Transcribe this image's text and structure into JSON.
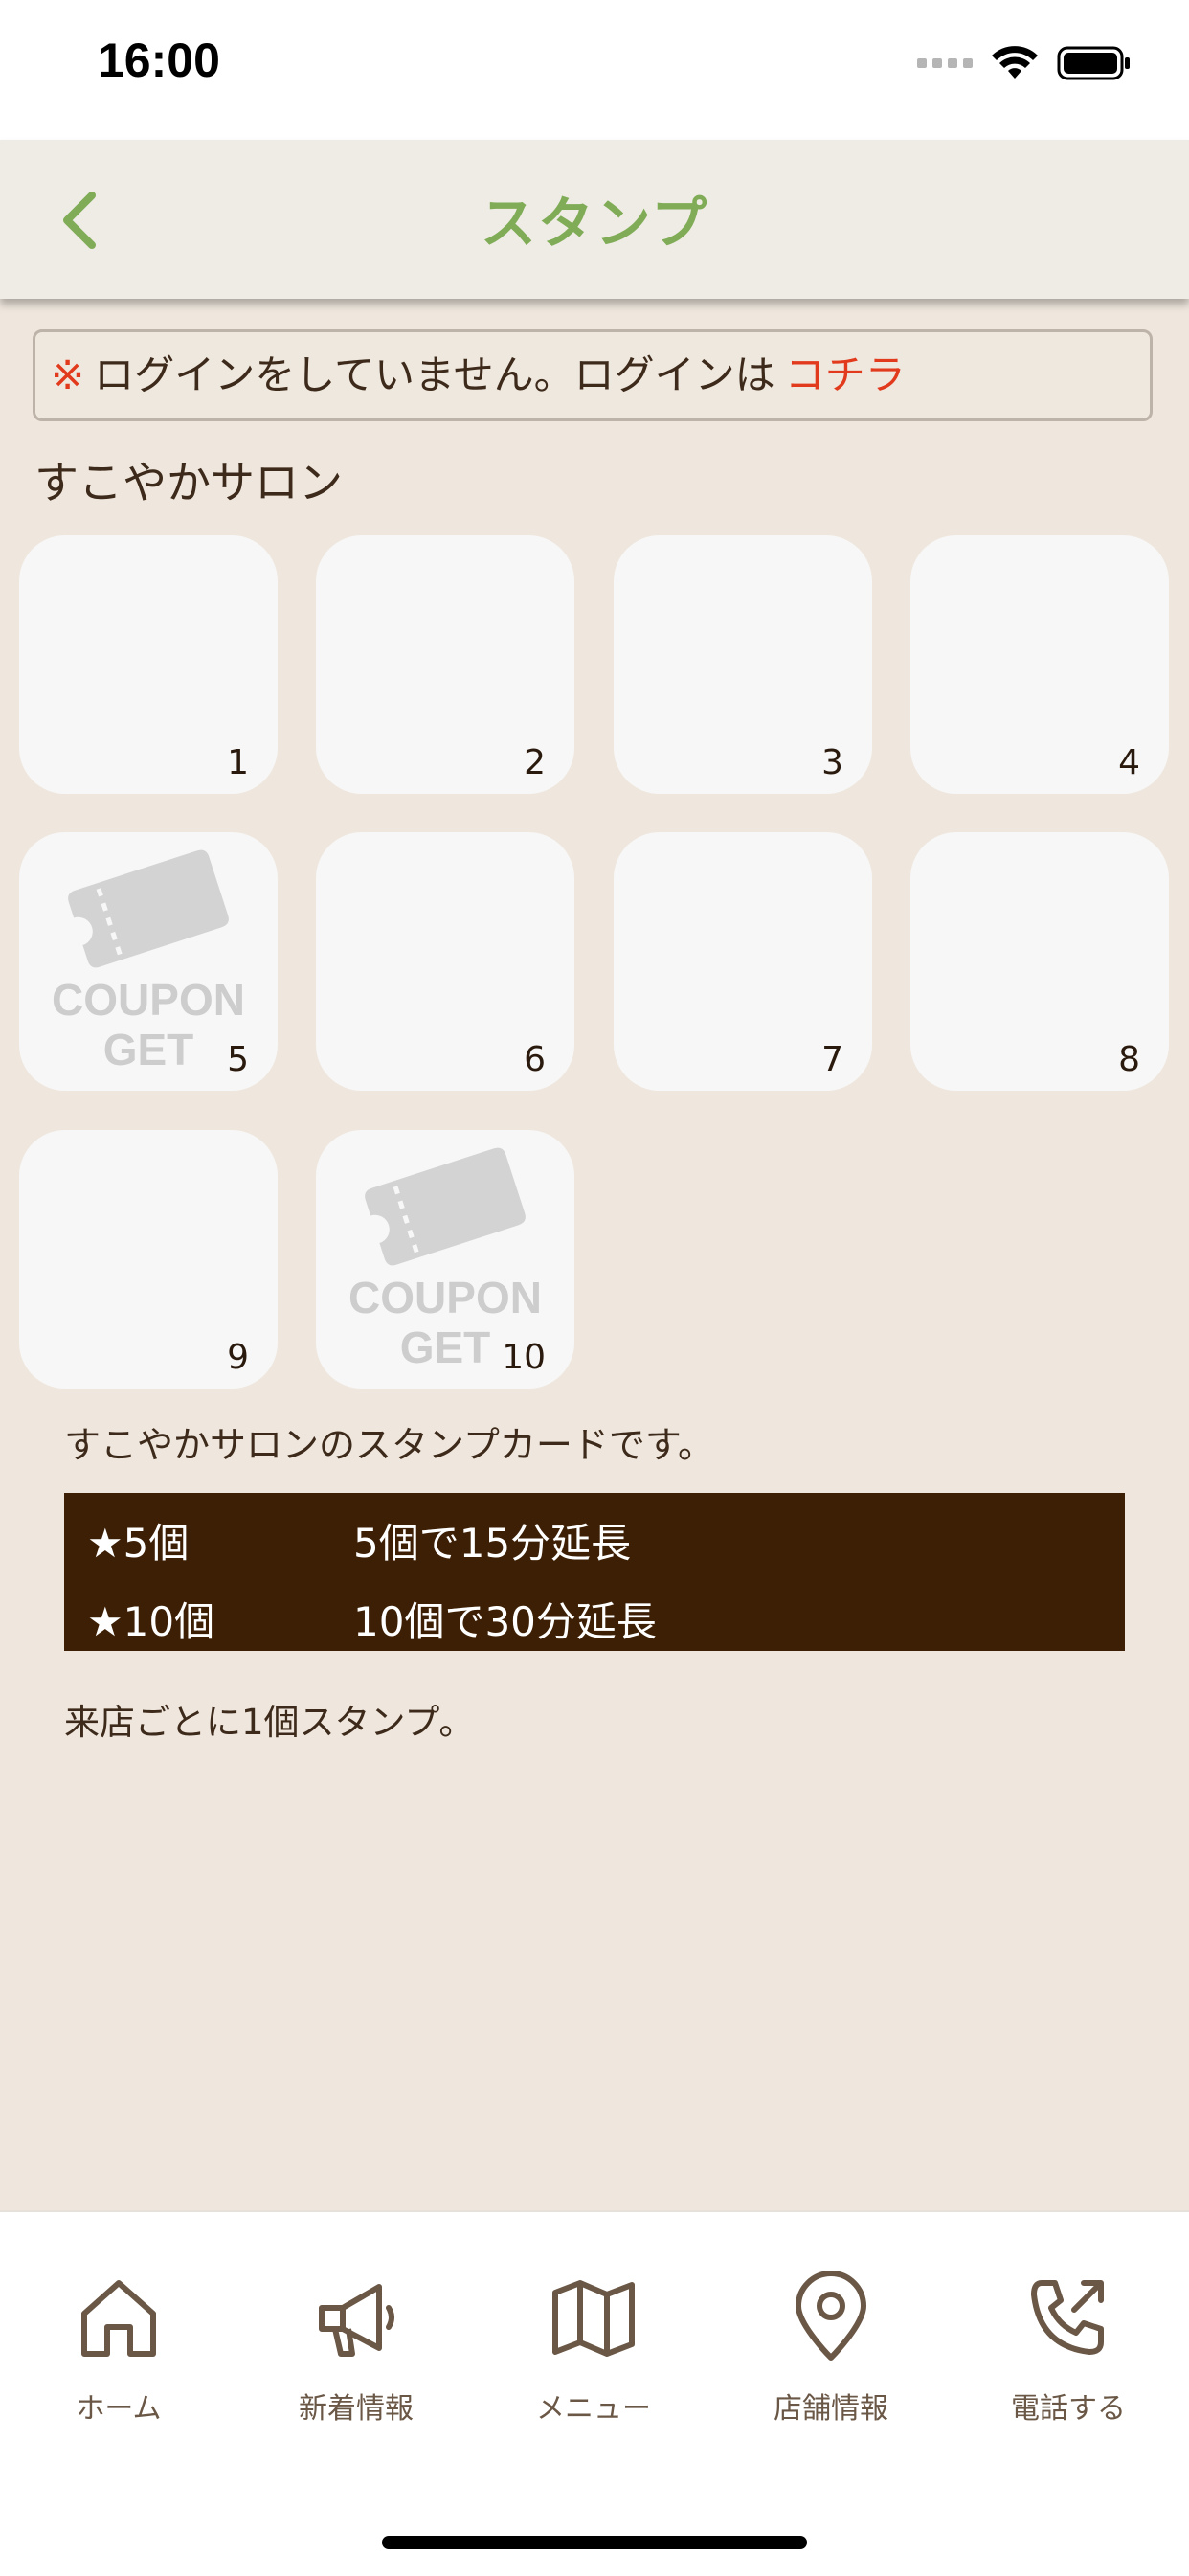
{
  "status_bar": {
    "time": "16:00"
  },
  "nav": {
    "title": "スタンプ"
  },
  "login_banner": {
    "mark": "※",
    "message": "ログインをしていません。ログインは",
    "link": "コチラ"
  },
  "shop": {
    "name": "すこやかサロン"
  },
  "stamps": [
    {
      "number": "1",
      "coupon": false
    },
    {
      "number": "2",
      "coupon": false
    },
    {
      "number": "3",
      "coupon": false
    },
    {
      "number": "4",
      "coupon": false
    },
    {
      "number": "5",
      "coupon": true
    },
    {
      "number": "6",
      "coupon": false
    },
    {
      "number": "7",
      "coupon": false
    },
    {
      "number": "8",
      "coupon": false
    },
    {
      "number": "9",
      "coupon": false
    },
    {
      "number": "10",
      "coupon": true
    }
  ],
  "coupon_label": {
    "line1": "COUPON",
    "line2": "GET"
  },
  "description": "すこやかサロンのスタンプカードです。",
  "rewards": [
    {
      "count": "★5個",
      "reward": "5個で15分延長"
    },
    {
      "count": "★10個",
      "reward": "10個で30分延長"
    }
  ],
  "note": "来店ごとに1個スタンプ。",
  "tabs": [
    {
      "label": "ホーム",
      "icon": "home-icon"
    },
    {
      "label": "新着情報",
      "icon": "megaphone-icon"
    },
    {
      "label": "メニュー",
      "icon": "map-icon"
    },
    {
      "label": "店舗情報",
      "icon": "location-pin-icon"
    },
    {
      "label": "電話する",
      "icon": "phone-icon"
    }
  ],
  "colors": {
    "accent_green": "#80AC57",
    "link_red": "#E23A1C",
    "background": "#EFE7DE",
    "reward_bg": "#3D1F05",
    "stamp_bg": "#F7F7F7",
    "tab_icon": "#6A5746"
  }
}
